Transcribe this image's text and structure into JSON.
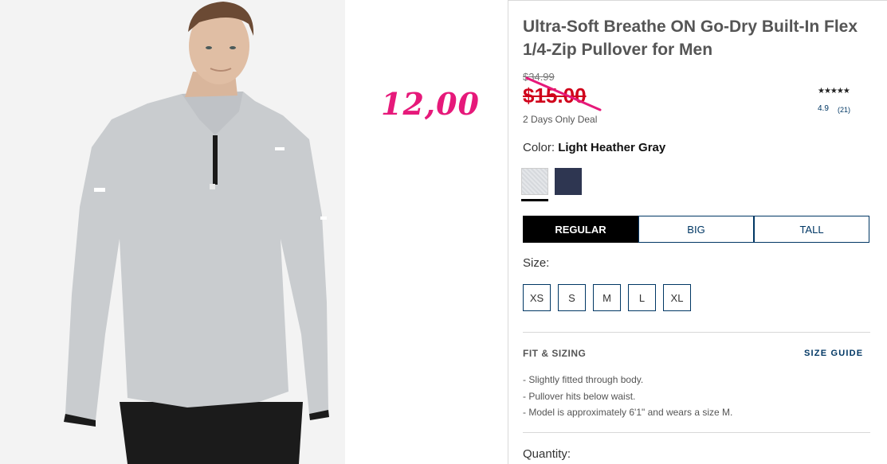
{
  "handwritten_price": "12,00",
  "product": {
    "title": "Ultra-Soft Breathe ON Go-Dry Built-In Flex 1/4-Zip Pullover for Men",
    "original_price": "$34.99",
    "sale_price": "$15.00",
    "deal_text": "2 Days Only Deal",
    "rating": {
      "stars": "★★★★★",
      "score": "4.9",
      "count": "(21)"
    },
    "color": {
      "label": "Color:",
      "value": "Light Heather Gray"
    },
    "swatches": [
      {
        "name": "Light Heather Gray",
        "color": "#dfe1e4",
        "selected": true
      },
      {
        "name": "Navy",
        "color": "#2e3651",
        "selected": false
      }
    ],
    "fit_tabs": [
      "REGULAR",
      "BIG",
      "TALL"
    ],
    "active_fit": "REGULAR",
    "size_label": "Size:",
    "sizes": [
      "XS",
      "S",
      "M",
      "L",
      "XL"
    ],
    "fit_sizing": {
      "heading": "FIT & SIZING",
      "size_guide": "SIZE GUIDE",
      "bullets": [
        "-  Slightly fitted through body.",
        "-  Pullover hits below waist.",
        "-  Model is approximately 6'1\" and wears a size M."
      ]
    },
    "quantity_label": "Quantity:"
  },
  "colors": {
    "sale_red": "#d0021b",
    "annotation_pink": "#e6197a",
    "brand_navy": "#003764"
  }
}
